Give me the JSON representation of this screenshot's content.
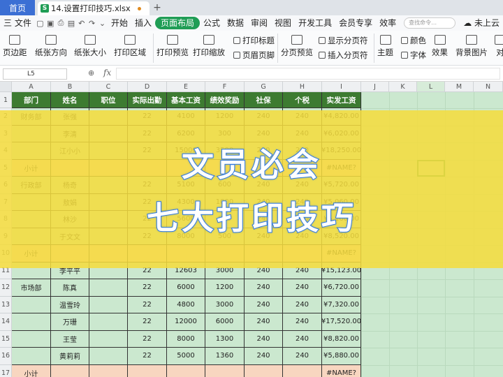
{
  "titlebar": {
    "home_tab": "首页",
    "file_badge": "S",
    "file_name": "14.设置打印技巧.xlsx",
    "new_tab": "+"
  },
  "menu": {
    "file": "三 文件",
    "tabs": [
      "开始",
      "插入",
      "页面布局",
      "公式",
      "数据",
      "审阅",
      "视图",
      "开发工具",
      "会员专享",
      "效率"
    ],
    "active_tab": "页面布局",
    "search_placeholder": "查找命令…",
    "cloud": "未上云"
  },
  "ribbon": {
    "margins": "页边距",
    "orientation": "纸张方向",
    "size": "纸张大小",
    "print_area": "打印区域",
    "print_preview": "打印预览",
    "print_scaling": "打印缩放",
    "print_titles": "打印标题",
    "header_footer": "页眉页脚",
    "page_break_preview": "分页预览",
    "show_page_breaks": "显示分页符",
    "insert_page_break": "插入分页符",
    "theme": "主题",
    "colors": "颜色",
    "fonts": "字体",
    "effects": "效果",
    "background": "背景图片",
    "align": "对"
  },
  "formula_bar": {
    "name_box": "L5",
    "fx": "fx"
  },
  "sheet": {
    "columns": [
      "A",
      "B",
      "C",
      "D",
      "E",
      "F",
      "G",
      "H",
      "I",
      "J",
      "K",
      "L",
      "M",
      "N"
    ],
    "headers": [
      "部门",
      "姓名",
      "职位",
      "实际出勤",
      "基本工资",
      "绩效奖励",
      "社保",
      "个税",
      "实发工资"
    ],
    "rows": [
      {
        "n": "2",
        "dept": "财务部",
        "name": "张强",
        "pos": "",
        "att": "22",
        "base": "4100",
        "bonus": "1200",
        "ss": "240",
        "tax": "240",
        "net": "¥4,820.00"
      },
      {
        "n": "3",
        "dept": "",
        "name": "李清",
        "pos": "",
        "att": "22",
        "base": "6200",
        "bonus": "300",
        "ss": "240",
        "tax": "240",
        "net": "¥6,020.00"
      },
      {
        "n": "4",
        "dept": "",
        "name": "江小小",
        "pos": "",
        "att": "22",
        "base": "15000",
        "bonus": "3500",
        "ss": "240",
        "tax": "240",
        "net": "¥18,250.00"
      },
      {
        "n": "5",
        "dept": "小计",
        "name": "",
        "pos": "",
        "att": "",
        "base": "",
        "bonus": "",
        "ss": "",
        "tax": "",
        "net": "#NAME?"
      },
      {
        "n": "6",
        "dept": "行政部",
        "name": "杨奇",
        "pos": "",
        "att": "22",
        "base": "5100",
        "bonus": "600",
        "ss": "240",
        "tax": "240",
        "net": "¥5,720.00"
      },
      {
        "n": "7",
        "dept": "",
        "name": "敖娟",
        "pos": "",
        "att": "22",
        "base": "4300",
        "bonus": "1000",
        "ss": "240",
        "tax": "240",
        "net": "¥5,060.00"
      },
      {
        "n": "8",
        "dept": "",
        "name": "林沙",
        "pos": "",
        "att": "22",
        "base": "5600",
        "bonus": "800",
        "ss": "240",
        "tax": "240",
        "net": "¥6,160.00"
      },
      {
        "n": "9",
        "dept": "",
        "name": "于文文",
        "pos": "",
        "att": "22",
        "base": "8000",
        "bonus": "500",
        "ss": "240",
        "tax": "240",
        "net": "¥8,520.00"
      },
      {
        "n": "10",
        "dept": "小计",
        "name": "",
        "pos": "",
        "att": "",
        "base": "",
        "bonus": "",
        "ss": "",
        "tax": "",
        "net": "#NAME?"
      },
      {
        "n": "11",
        "dept": "",
        "name": "李平平",
        "pos": "",
        "att": "22",
        "base": "12603",
        "bonus": "3000",
        "ss": "240",
        "tax": "240",
        "net": "¥15,123.00"
      },
      {
        "n": "12",
        "dept": "市场部",
        "name": "陈真",
        "pos": "",
        "att": "22",
        "base": "6000",
        "bonus": "1200",
        "ss": "240",
        "tax": "240",
        "net": "¥6,720.00"
      },
      {
        "n": "13",
        "dept": "",
        "name": "温雪玲",
        "pos": "",
        "att": "22",
        "base": "4800",
        "bonus": "3000",
        "ss": "240",
        "tax": "240",
        "net": "¥7,320.00"
      },
      {
        "n": "14",
        "dept": "",
        "name": "万珊",
        "pos": "",
        "att": "22",
        "base": "12000",
        "bonus": "6000",
        "ss": "240",
        "tax": "240",
        "net": "¥17,520.00"
      },
      {
        "n": "15",
        "dept": "",
        "name": "王莹",
        "pos": "",
        "att": "22",
        "base": "8000",
        "bonus": "1300",
        "ss": "240",
        "tax": "240",
        "net": "¥8,820.00"
      },
      {
        "n": "16",
        "dept": "",
        "name": "黄莉莉",
        "pos": "",
        "att": "22",
        "base": "5000",
        "bonus": "1360",
        "ss": "240",
        "tax": "240",
        "net": "¥5,880.00"
      },
      {
        "n": "17",
        "dept": "小计",
        "name": "",
        "pos": "",
        "att": "",
        "base": "",
        "bonus": "",
        "ss": "",
        "tax": "",
        "net": "#NAME?"
      }
    ]
  },
  "overlay": {
    "line1": "文员必会",
    "line2": "七大打印技巧"
  }
}
